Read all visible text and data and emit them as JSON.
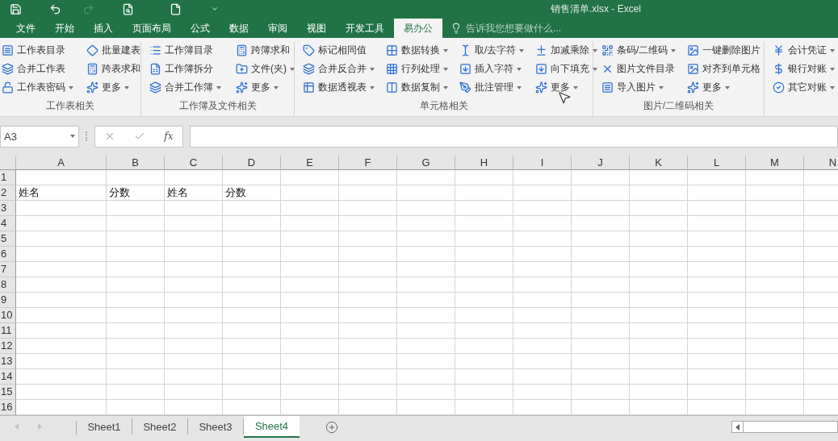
{
  "window": {
    "title": "销售清单.xlsx - Excel"
  },
  "quick_access": [
    {
      "kind": "save",
      "disabled": false
    },
    {
      "kind": "undo",
      "disabled": false
    },
    {
      "kind": "redo",
      "disabled": true
    },
    {
      "kind": "preview",
      "disabled": false
    },
    {
      "kind": "new",
      "disabled": false
    },
    {
      "kind": "customize",
      "disabled": false
    }
  ],
  "ribbon_tabs": [
    {
      "label": "文件",
      "selected": false
    },
    {
      "label": "开始",
      "selected": false
    },
    {
      "label": "插入",
      "selected": false
    },
    {
      "label": "页面布局",
      "selected": false
    },
    {
      "label": "公式",
      "selected": false
    },
    {
      "label": "数据",
      "selected": false
    },
    {
      "label": "审阅",
      "selected": false
    },
    {
      "label": "视图",
      "selected": false
    },
    {
      "label": "开发工具",
      "selected": false
    },
    {
      "label": "易办公",
      "selected": true
    }
  ],
  "tell_me": {
    "placeholder": "告诉我您想要做什么..."
  },
  "ribbon_groups": [
    {
      "label": "工作表相关",
      "columns": [
        [
          {
            "label": "工作表目录",
            "dropdown": false
          },
          {
            "label": "合并工作表",
            "dropdown": false
          },
          {
            "label": "工作表密码",
            "dropdown": true
          }
        ],
        [
          {
            "label": "批量建表",
            "dropdown": false
          },
          {
            "label": "跨表求和",
            "dropdown": false
          },
          {
            "label": "更多",
            "dropdown": true
          }
        ]
      ]
    },
    {
      "label": "工作簿及文件相关",
      "columns": [
        [
          {
            "label": "工作簿目录",
            "dropdown": false
          },
          {
            "label": "工作簿拆分",
            "dropdown": false
          },
          {
            "label": "合并工作簿",
            "dropdown": true
          }
        ],
        [
          {
            "label": "跨簿求和",
            "dropdown": false
          },
          {
            "label": "文件(夹)",
            "dropdown": true
          },
          {
            "label": "更多",
            "dropdown": true
          }
        ]
      ]
    },
    {
      "label": "单元格相关",
      "columns": [
        [
          {
            "label": "标记相同值",
            "dropdown": false
          },
          {
            "label": "合并反合并",
            "dropdown": true
          },
          {
            "label": "数据透视表",
            "dropdown": true
          }
        ],
        [
          {
            "label": "数据转换",
            "dropdown": true
          },
          {
            "label": "行列处理",
            "dropdown": true
          },
          {
            "label": "数据复制",
            "dropdown": true
          }
        ],
        [
          {
            "label": "取/去字符",
            "dropdown": true
          },
          {
            "label": "插入字符",
            "dropdown": true
          },
          {
            "label": "批注管理",
            "dropdown": true
          }
        ],
        [
          {
            "label": "加减乘除",
            "dropdown": true
          },
          {
            "label": "向下填充",
            "dropdown": true
          },
          {
            "label": "更多",
            "dropdown": true
          }
        ]
      ]
    },
    {
      "label": "图片/二维码相关",
      "columns": [
        [
          {
            "label": "条码/二维码",
            "dropdown": true
          },
          {
            "label": "图片文件目录",
            "dropdown": false
          },
          {
            "label": "导入图片",
            "dropdown": true
          }
        ],
        [
          {
            "label": "一键删除图片",
            "dropdown": false
          },
          {
            "label": "对齐到单元格",
            "dropdown": false
          },
          {
            "label": "更多",
            "dropdown": true
          }
        ]
      ]
    },
    {
      "columns": [
        [
          {
            "label": "会计凭证",
            "dropdown": true
          },
          {
            "label": "银行对账",
            "dropdown": true
          },
          {
            "label": "其它对账",
            "dropdown": true
          }
        ]
      ]
    }
  ],
  "name_box": {
    "value": "A3"
  },
  "formula_bar": {
    "fx_label": "fx"
  },
  "sheet": {
    "columns": [
      "A",
      "B",
      "C",
      "D",
      "E",
      "F",
      "G",
      "H",
      "I",
      "J",
      "K",
      "L",
      "M",
      "N"
    ],
    "rows": [
      {
        "label": "1",
        "cells": []
      },
      {
        "label": "2",
        "cells": [
          "姓名",
          "分数",
          "姓名",
          "分数"
        ]
      },
      {
        "label": "3"
      },
      {
        "label": "4"
      },
      {
        "label": "5"
      },
      {
        "label": "6"
      },
      {
        "label": "7"
      },
      {
        "label": "8"
      },
      {
        "label": "9"
      },
      {
        "label": "10"
      },
      {
        "label": "11"
      },
      {
        "label": "12"
      },
      {
        "label": "13"
      },
      {
        "label": "14"
      },
      {
        "label": "15"
      },
      {
        "label": "16"
      }
    ]
  },
  "sheet_tabs": [
    {
      "label": "Sheet1",
      "selected": false
    },
    {
      "label": "Sheet2",
      "selected": false
    },
    {
      "label": "Sheet3",
      "selected": false
    },
    {
      "label": "Sheet4",
      "selected": true
    }
  ]
}
